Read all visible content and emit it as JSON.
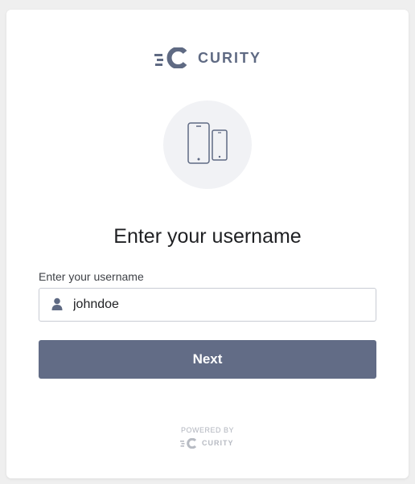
{
  "brand": {
    "name": "CURITY",
    "logo_icon": "curity-logo-icon",
    "color": "#5f6a83"
  },
  "illustration": {
    "icon": "mobile-devices-icon"
  },
  "form": {
    "heading": "Enter your username",
    "username_label": "Enter your username",
    "username_value": "johndoe",
    "username_icon": "user-icon",
    "next_label": "Next",
    "button_color": "#626c86"
  },
  "footer": {
    "powered_by": "POWERED BY",
    "brand_name": "CURITY"
  }
}
